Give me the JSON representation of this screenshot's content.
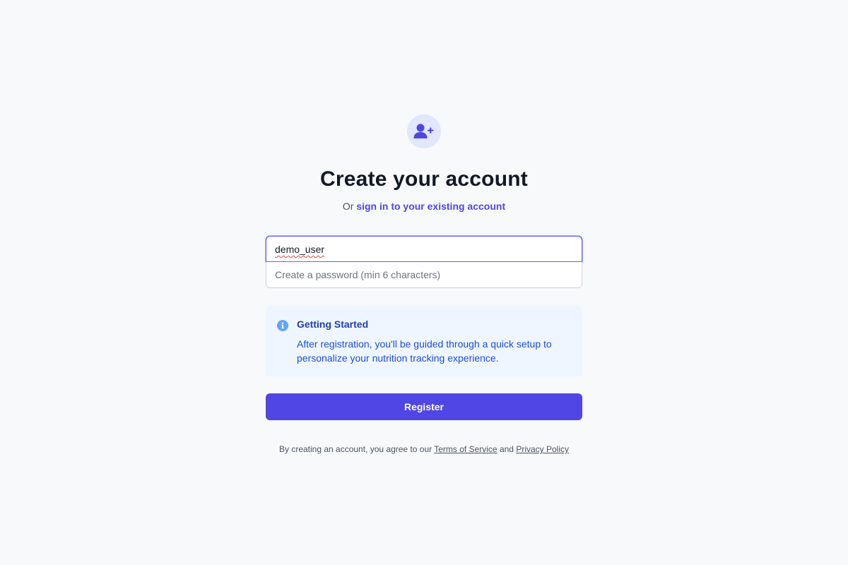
{
  "header": {
    "title": "Create your account",
    "subtitle_prefix": "Or",
    "signin_link": "sign in to your existing account"
  },
  "form": {
    "username_value": "demo_user",
    "password_placeholder": "Create a password (min 6 characters)"
  },
  "info": {
    "title": "Getting Started",
    "text": "After registration, you'll be guided through a quick setup to personalize your nutrition tracking experience."
  },
  "actions": {
    "register_label": "Register"
  },
  "legal": {
    "prefix": "By creating an account, you agree to our",
    "terms_link": "Terms of Service",
    "and": "and",
    "privacy_link": "Privacy Policy"
  },
  "colors": {
    "accent": "#4f46e5",
    "avatar_bg": "#e0e7ff",
    "info_bg": "#eff6ff",
    "info_text": "#1d4ed8",
    "page_bg": "#f8f9fb"
  },
  "icons": {
    "avatar": "user-plus-icon",
    "info": "info-circle-icon"
  }
}
